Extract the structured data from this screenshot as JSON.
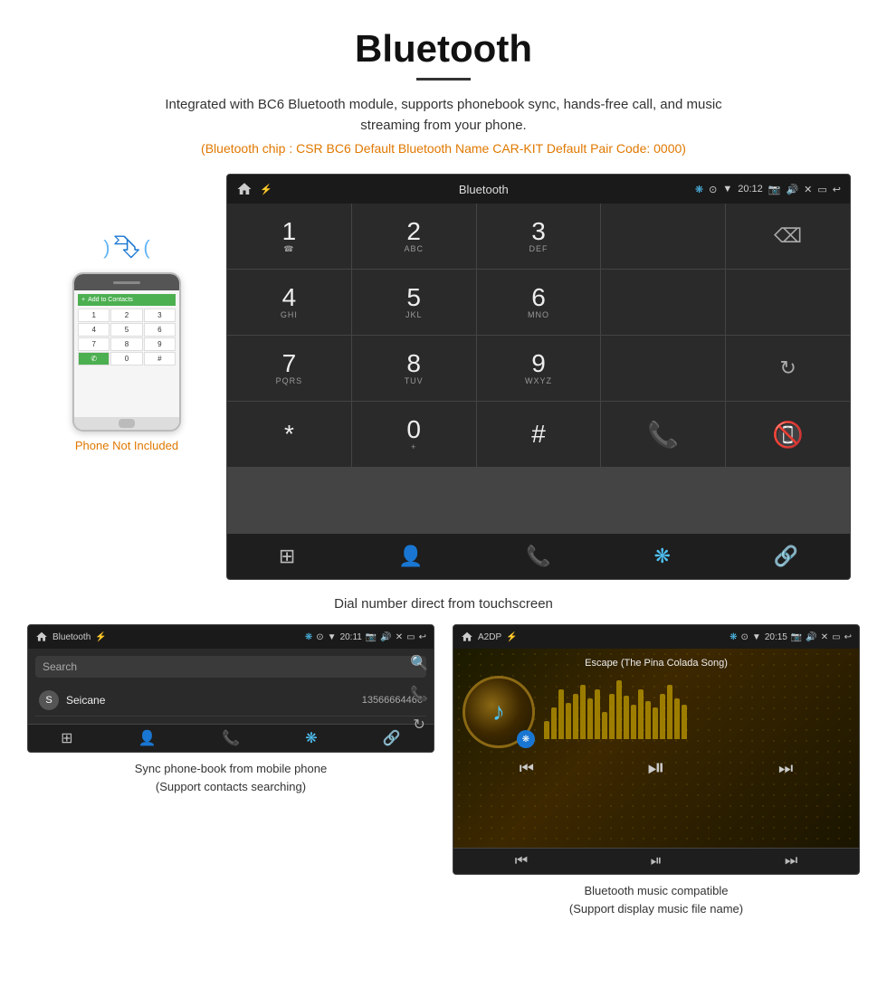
{
  "header": {
    "title": "Bluetooth",
    "description": "Integrated with BC6 Bluetooth module, supports phonebook sync, hands-free call, and music streaming from your phone.",
    "specs": "(Bluetooth chip : CSR BC6    Default Bluetooth Name CAR-KIT    Default Pair Code: 0000)"
  },
  "phone_label": "Phone Not Included",
  "main_screen": {
    "status_bar": {
      "screen_label": "Bluetooth",
      "time": "20:12",
      "usb_icon": "⚡",
      "bt_icon": "❋",
      "location_icon": "⊙",
      "wifi_icon": "▼"
    },
    "dialpad": {
      "keys": [
        {
          "main": "1",
          "sub": ""
        },
        {
          "main": "2",
          "sub": "ABC"
        },
        {
          "main": "3",
          "sub": "DEF"
        },
        {
          "main": "",
          "sub": ""
        },
        {
          "main": "⌫",
          "sub": ""
        },
        {
          "main": "4",
          "sub": "GHI"
        },
        {
          "main": "5",
          "sub": "JKL"
        },
        {
          "main": "6",
          "sub": "MNO"
        },
        {
          "main": "",
          "sub": ""
        },
        {
          "main": "",
          "sub": ""
        },
        {
          "main": "7",
          "sub": "PQRS"
        },
        {
          "main": "8",
          "sub": "TUV"
        },
        {
          "main": "9",
          "sub": "WXYZ"
        },
        {
          "main": "",
          "sub": ""
        },
        {
          "main": "↺",
          "sub": ""
        },
        {
          "main": "*",
          "sub": ""
        },
        {
          "main": "0",
          "sub": "+"
        },
        {
          "main": "#",
          "sub": ""
        },
        {
          "main": "📞",
          "sub": ""
        },
        {
          "main": "📵",
          "sub": ""
        }
      ]
    },
    "bottom_nav": [
      "⊞",
      "👤",
      "📞",
      "❋",
      "🔗"
    ]
  },
  "main_caption": "Dial number direct from touchscreen",
  "phonebook_screen": {
    "status_bar": {
      "label": "Bluetooth",
      "time": "20:11"
    },
    "search_placeholder": "Search",
    "contacts": [
      {
        "letter": "S",
        "name": "Seicane",
        "number": "13566664466"
      }
    ],
    "side_icons": [
      "🔍",
      "📞",
      "↺"
    ]
  },
  "music_screen": {
    "status_bar": {
      "label": "A2DP",
      "time": "20:15"
    },
    "song_title": "Escape (The Pina Colada Song)",
    "eq_bars": [
      20,
      35,
      55,
      40,
      50,
      60,
      45,
      55,
      30,
      50,
      65,
      48,
      38,
      55,
      42,
      35,
      50,
      60,
      45,
      38
    ],
    "controls": [
      "⏮",
      "⏯",
      "⏭"
    ]
  },
  "bottom_captions": {
    "phonebook": "Sync phone-book from mobile phone\n(Support contacts searching)",
    "music": "Bluetooth music compatible\n(Support display music file name)"
  },
  "phonebook_caption_line1": "Sync phone-book from mobile phone",
  "phonebook_caption_line2": "(Support contacts searching)",
  "music_caption_line1": "Bluetooth music compatible",
  "music_caption_line2": "(Support display music file name)"
}
